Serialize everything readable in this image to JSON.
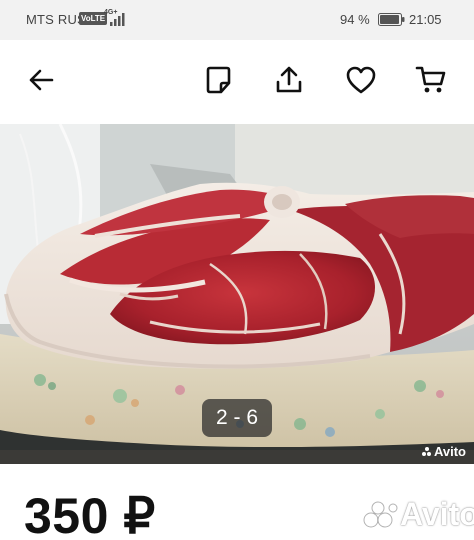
{
  "status_bar": {
    "carrier": "MTS RUS",
    "volte": "VoLTE",
    "network": "4G+",
    "battery_percent": "94 %",
    "time": "21:05"
  },
  "toolbar": {
    "back_icon": "arrow-left-icon",
    "note_icon": "note-icon",
    "share_icon": "share-icon",
    "favorite_icon": "heart-icon",
    "cart_icon": "cart-icon"
  },
  "gallery": {
    "counter": "2 - 6",
    "watermark": "Avito"
  },
  "listing": {
    "price": "350 ₽",
    "watermark": "Avito"
  },
  "colors": {
    "status_bar_bg": "#f2f2f2",
    "counter_bg": "#282828"
  }
}
